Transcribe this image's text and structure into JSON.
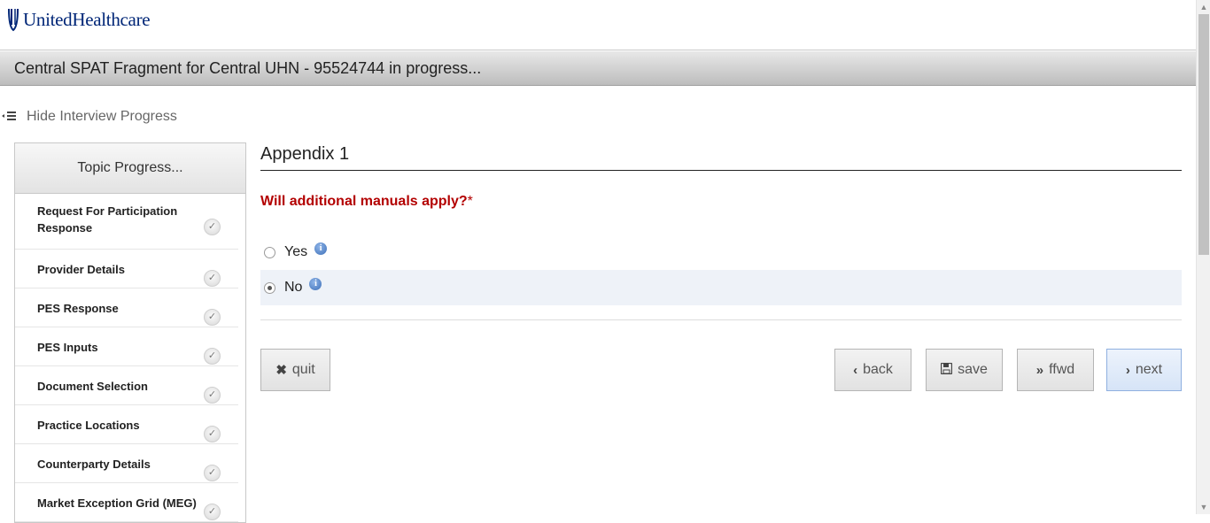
{
  "brand": {
    "name": "UnitedHealthcare"
  },
  "titlebar": {
    "text": "Central SPAT Fragment for Central UHN - 95524744 in progress..."
  },
  "progress_toggle": {
    "icon": "list-collapse-icon",
    "label": "Hide Interview Progress"
  },
  "topic_panel": {
    "heading": "Topic Progress...",
    "items": [
      {
        "label": "Request For Participation Response",
        "status": "complete"
      },
      {
        "label": "Provider Details",
        "status": "complete"
      },
      {
        "label": "PES Response",
        "status": "complete"
      },
      {
        "label": "PES Inputs",
        "status": "complete"
      },
      {
        "label": "Document Selection",
        "status": "complete"
      },
      {
        "label": "Practice Locations",
        "status": "complete"
      },
      {
        "label": "Counterparty Details",
        "status": "complete"
      },
      {
        "label": "Market Exception Grid (MEG)",
        "status": "complete"
      }
    ]
  },
  "main": {
    "title": "Appendix 1",
    "question": "Will additional manuals apply?",
    "required_marker": "*",
    "options": [
      {
        "label": "Yes",
        "selected": false
      },
      {
        "label": "No",
        "selected": true
      }
    ]
  },
  "buttons": {
    "quit": "quit",
    "back": "back",
    "save": "save",
    "ffwd": "ffwd",
    "next": "next"
  },
  "colors": {
    "brand": "#002677",
    "question": "#b30000",
    "selected_row": "#eef2f8",
    "primary_button": "#d6e4f7"
  }
}
